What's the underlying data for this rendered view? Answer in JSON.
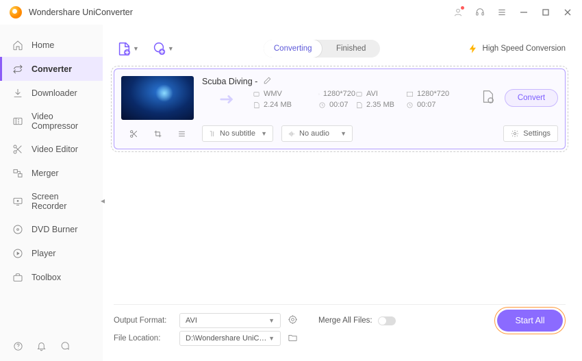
{
  "app": {
    "title": "Wondershare UniConverter"
  },
  "sidebar": {
    "items": [
      {
        "label": "Home"
      },
      {
        "label": "Converter"
      },
      {
        "label": "Downloader"
      },
      {
        "label": "Video Compressor"
      },
      {
        "label": "Video Editor"
      },
      {
        "label": "Merger"
      },
      {
        "label": "Screen Recorder"
      },
      {
        "label": "DVD Burner"
      },
      {
        "label": "Player"
      },
      {
        "label": "Toolbox"
      }
    ]
  },
  "toolbar": {
    "tabs": {
      "converting": "Converting",
      "finished": "Finished"
    },
    "hsc": "High Speed Conversion"
  },
  "file": {
    "title": "Scuba Diving -",
    "src": {
      "format": "WMV",
      "res": "1280*720",
      "size": "2.24 MB",
      "dur": "00:07"
    },
    "dst": {
      "format": "AVI",
      "res": "1280*720",
      "size": "2.35 MB",
      "dur": "00:07"
    },
    "convert": "Convert",
    "subtitle": "No subtitle",
    "audio": "No audio",
    "settings": "Settings"
  },
  "footer": {
    "output_format_label": "Output Format:",
    "output_format": "AVI",
    "file_location_label": "File Location:",
    "file_location": "D:\\Wondershare UniConvert",
    "merge_label": "Merge All Files:",
    "start_all": "Start All"
  }
}
